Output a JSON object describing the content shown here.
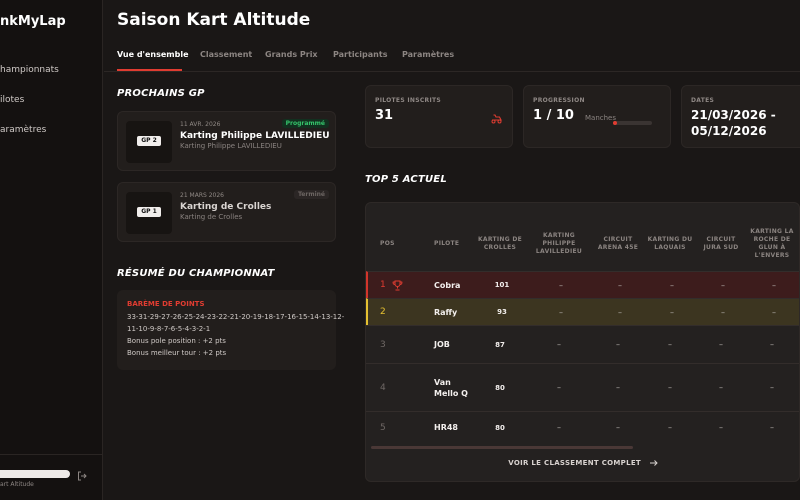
{
  "sidebar": {
    "brand": "nkMyLap",
    "items": [
      {
        "label": "hampionnats"
      },
      {
        "label": "ilotes"
      },
      {
        "label": "aramètres"
      }
    ],
    "footer_caption": "art Altitude"
  },
  "header": {
    "title": "Saison Kart Altitude",
    "tabs": [
      {
        "label": "Vue d'ensemble",
        "active": true
      },
      {
        "label": "Classement"
      },
      {
        "label": "Grands Prix"
      },
      {
        "label": "Participants"
      },
      {
        "label": "Paramètres"
      }
    ]
  },
  "upcoming": {
    "title": "PROCHAINS GP",
    "cards": [
      {
        "badge": "GP 2",
        "date": "11 AVR. 2026",
        "name": "Karting Philippe LAVILLEDIEU",
        "location": "Karting Philippe LAVILLEDIEU",
        "status": "Programmé"
      },
      {
        "badge": "GP 1",
        "date": "21 MARS 2026",
        "name": "Karting de Crolles",
        "location": "Karting de Crolles",
        "status": "Terminé"
      }
    ]
  },
  "summary": {
    "title": "RÉSUMÉ DU CHAMPIONNAT",
    "points_heading": "BARÈME DE POINTS",
    "points_line1": "33-31-29-27-26-25-24-23-22-21-20-19-18-17-16-15-14-13-12-",
    "points_line2": "11-10-9-8-7-6-5-4-3-2-1",
    "bonus_pole": "Bonus pole position : +2 pts",
    "bonus_lap": "Bonus meilleur tour : +2 pts"
  },
  "stats": {
    "drivers_label": "PILOTES INSCRITS",
    "drivers_value": "31",
    "progress_label": "PROGRESSION",
    "progress_value": "1 / 10",
    "progress_unit": "Manches",
    "progress_fraction": 0.1,
    "dates_label": "DATES",
    "date_start": "21/03/2026 -",
    "date_end": "05/12/2026"
  },
  "top5": {
    "title": "TOP 5 ACTUEL",
    "columns": [
      "POS",
      "PILOTE",
      "KARTING DE CROLLES",
      "KARTING PHILIPPE LAVILLEDIEU",
      "CIRCUIT ARENA 45E",
      "KARTING DU LAQUAIS",
      "CIRCUIT JURA SUD",
      "KARTING LA ROCHE DE GLUN À L'ENVERS"
    ],
    "rows": [
      {
        "pos": "1",
        "name": "Cobra",
        "pts": "101",
        "cells": [
          "–",
          "–",
          "–",
          "–",
          "–"
        ]
      },
      {
        "pos": "2",
        "name": "Raffy",
        "pts": "93",
        "cells": [
          "–",
          "–",
          "–",
          "–",
          "–"
        ]
      },
      {
        "pos": "3",
        "name": "JOB",
        "pts": "87",
        "cells": [
          "–",
          "–",
          "–",
          "–",
          "–"
        ]
      },
      {
        "pos": "4",
        "name": "Van Mello Q",
        "pts": "80",
        "cells": [
          "–",
          "–",
          "–",
          "–",
          "–"
        ]
      },
      {
        "pos": "5",
        "name": "HR48",
        "pts": "80",
        "cells": [
          "–",
          "–",
          "–",
          "–",
          "–"
        ]
      }
    ],
    "footer_link": "VOIR LE CLASSEMENT COMPLET"
  },
  "colors": {
    "accent": "#e03c31",
    "gold": "#e4c031",
    "success": "#35c46b"
  }
}
